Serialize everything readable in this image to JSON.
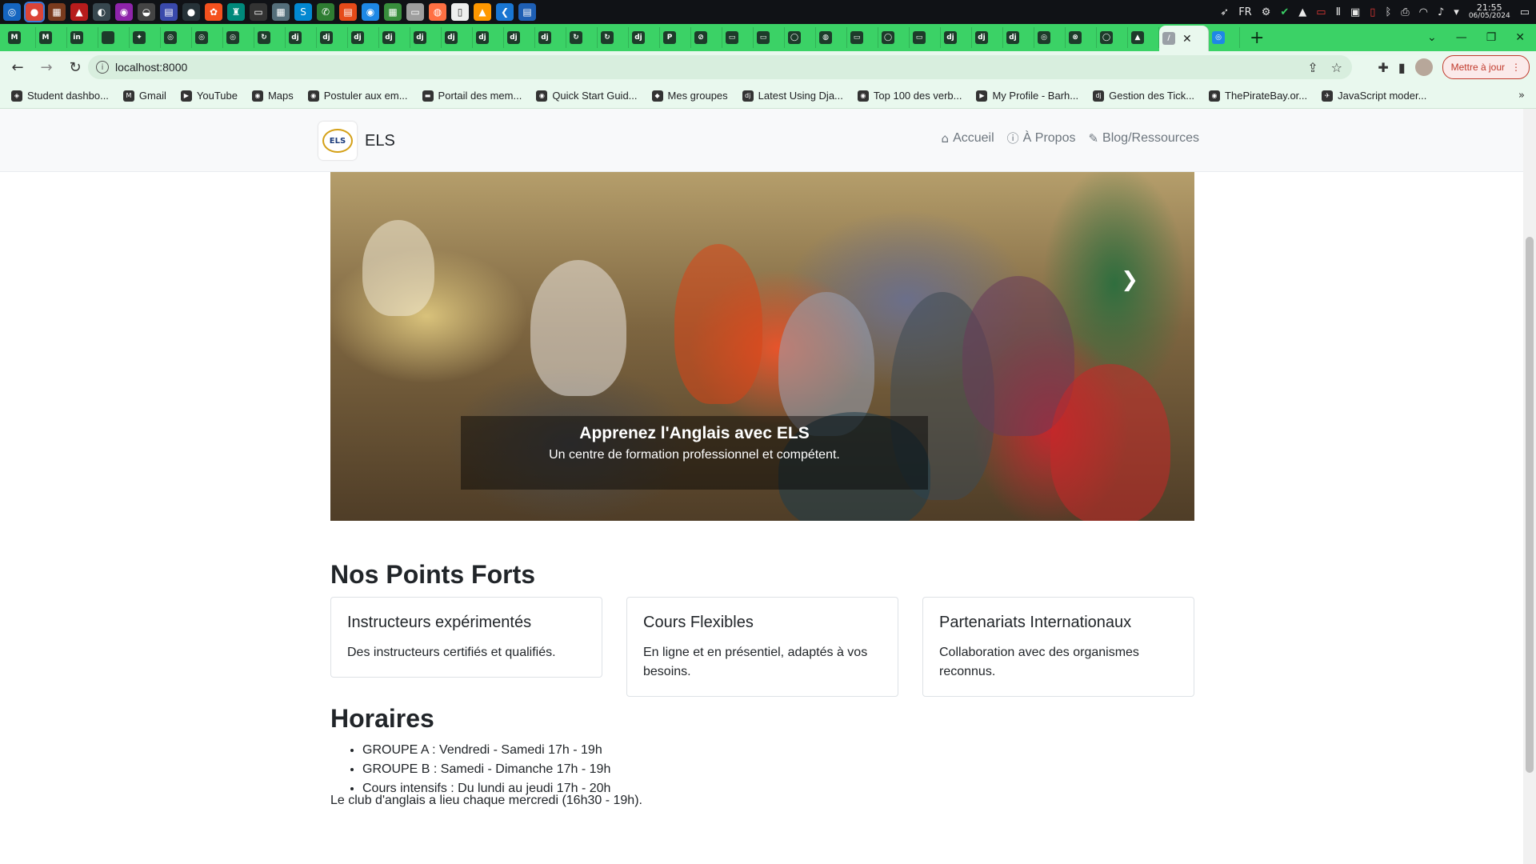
{
  "taskbar": {
    "lang": "FR",
    "time": "21:55",
    "date": "06/05/2024"
  },
  "browser": {
    "url": "localhost:8000",
    "update_label": "Mettre à jour",
    "bookmarks": [
      "Student dashbo...",
      "Gmail",
      "YouTube",
      "Maps",
      "Postuler aux em...",
      "Portail des mem...",
      "Quick Start Guid...",
      "Mes groupes",
      "Latest Using Dja...",
      "Top 100 des verb...",
      "My Profile - Barh...",
      "Gestion des Tick...",
      "ThePirateBay.or...",
      "JavaScript moder..."
    ]
  },
  "site": {
    "brand": "ELS",
    "logo_text": "ELS",
    "nav": [
      "Accueil",
      "À Propos",
      "Blog/Ressources"
    ],
    "hero": {
      "title": "Apprenez l'Anglais avec ELS",
      "subtitle": "Un centre de formation professionnel et compétent."
    },
    "strengths": {
      "title": "Nos Points Forts",
      "cards": [
        {
          "title": "Instructeurs expérimentés",
          "text": "Des instructeurs certifiés et qualifiés."
        },
        {
          "title": "Cours Flexibles",
          "text": "En ligne et en présentiel, adaptés à vos besoins."
        },
        {
          "title": "Partenariats Internationaux",
          "text": "Collaboration avec des organismes reconnus."
        }
      ]
    },
    "schedule": {
      "title": "Horaires",
      "items": [
        "GROUPE A : Vendredi - Samedi 17h - 19h",
        "GROUPE B : Samedi - Dimanche 17h - 19h",
        "Cours intensifs : Du lundi au jeudi 17h - 20h"
      ],
      "club": "Le club d'anglais a lieu chaque mercredi (16h30 - 19h)."
    }
  },
  "colors": {
    "tab_strip": "#3bd266",
    "toolbar": "#e9f8ee",
    "update_button": "#c0392b"
  }
}
